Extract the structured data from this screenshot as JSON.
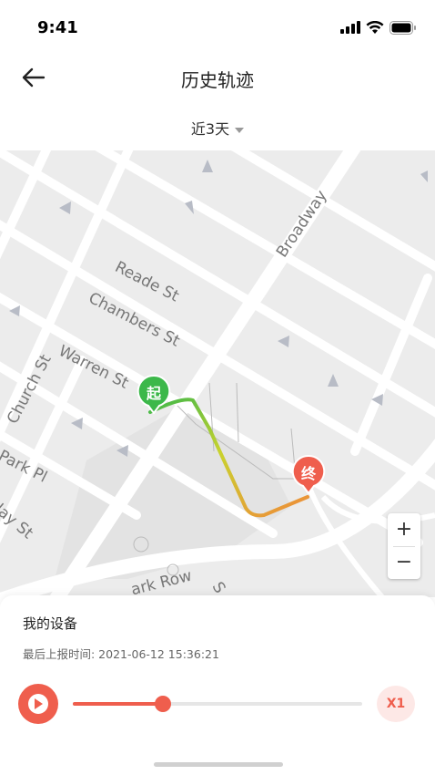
{
  "status_bar": {
    "time": "9:41"
  },
  "nav": {
    "title": "历史轨迹"
  },
  "filter": {
    "label": "近3天"
  },
  "map": {
    "streets": [
      "Reade St",
      "Chambers St",
      "Warren St",
      "Church St",
      "Park Pl",
      "clay St",
      "Broadway",
      "ark Row",
      "S"
    ],
    "start_marker": "起",
    "end_marker": "终",
    "route_start_color": "#3cb84a",
    "route_end_color": "#f08a3a",
    "zoom_in": "+",
    "zoom_out": "−"
  },
  "device": {
    "name": "我的设备",
    "last_report": "最后上报时间: 2021-06-12 15:36:21"
  },
  "playback": {
    "progress_percent": 31,
    "speed": "X1"
  },
  "colors": {
    "accent": "#ef5e4d",
    "start_green": "#3cb84a"
  }
}
